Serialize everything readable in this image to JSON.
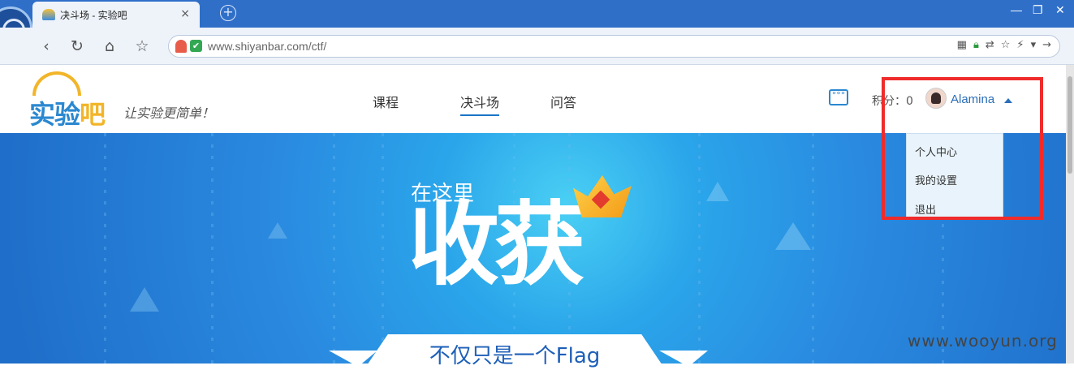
{
  "browser": {
    "tab_title": "决斗场 - 实验吧",
    "tab_close": "×",
    "new_tab": "+",
    "window_controls": [
      "—",
      "❐",
      "✕"
    ],
    "nav_buttons": [
      "‹",
      "↻",
      "⌂",
      "☆"
    ],
    "url": "www.shiyanbar.com/ctf/",
    "url_icons": [
      "qr-code-icon",
      "lock-icon",
      "translate-icon",
      "star-icon",
      "bolt-icon",
      "dropdown-icon",
      "forward-icon"
    ]
  },
  "site": {
    "logo_text": "实验吧",
    "logo_highlight": "吧",
    "slogan": "让实验更简单！",
    "nav": [
      "课程",
      "决斗场",
      "问答"
    ],
    "active_nav": "决斗场",
    "score_label": "积分：0",
    "username": "Alamina",
    "dropdown": [
      "个人中心",
      "我的设置",
      "退出"
    ]
  },
  "banner": {
    "small_text": "在这里",
    "big_text": "收获",
    "subtitle": "不仅只是一个Flag"
  },
  "watermark": "www.wooyun.org",
  "colors": {
    "accent": "#2b88d0",
    "highlight_border": "#ef2b2b",
    "banner": "#2a8ae0"
  }
}
